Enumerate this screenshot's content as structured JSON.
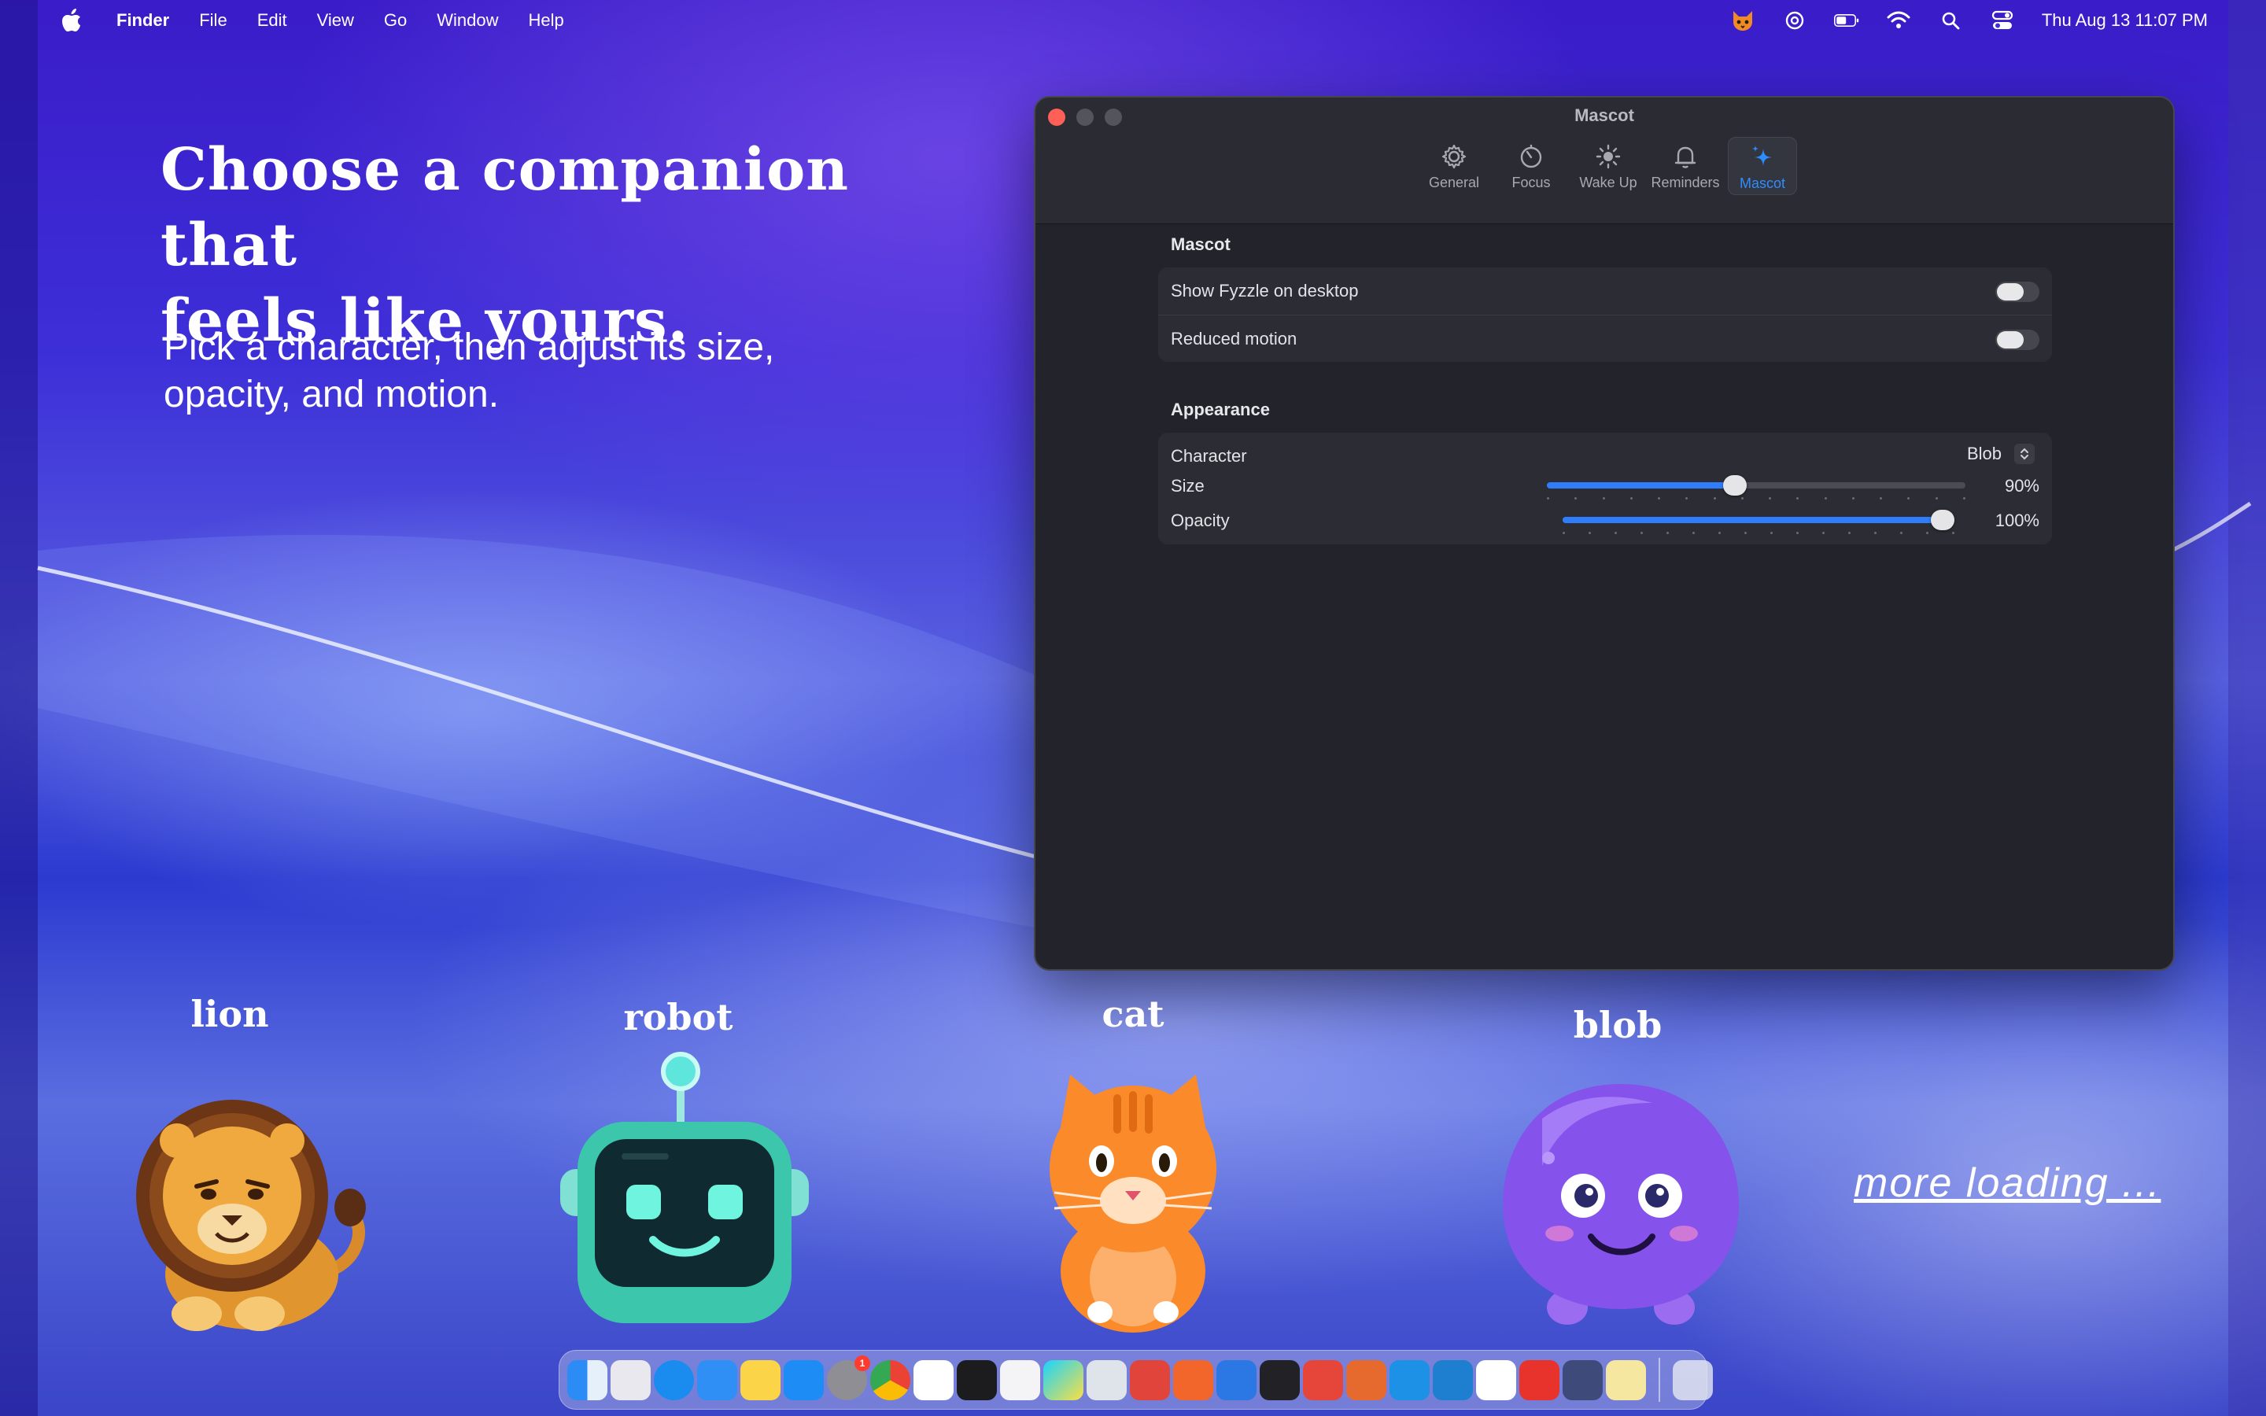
{
  "menubar": {
    "app_name": "Finder",
    "menus": [
      "File",
      "Edit",
      "View",
      "Go",
      "Window",
      "Help"
    ],
    "status_icons": [
      "mascot-cat-icon",
      "chatgpt-icon",
      "battery-icon",
      "wifi-icon",
      "spotlight-search-icon",
      "control-center-icon"
    ],
    "clock": "Thu Aug 13  11:07 PM"
  },
  "hero": {
    "title_line1": "Choose a companion that",
    "title_line2": "feels like yours.",
    "subtitle_line1": "Pick a character, then adjust its size,",
    "subtitle_line2": "opacity, and motion."
  },
  "window": {
    "title": "Mascot",
    "tabs": [
      {
        "label": "General",
        "icon": "gear-icon"
      },
      {
        "label": "Focus",
        "icon": "timer-icon"
      },
      {
        "label": "Wake Up",
        "icon": "sun-icon"
      },
      {
        "label": "Reminders",
        "icon": "bell-icon"
      },
      {
        "label": "Mascot",
        "icon": "sparkles-icon",
        "active": true
      }
    ],
    "mascot_section": {
      "heading": "Mascot",
      "show_on_desktop_label": "Show Fyzzle on desktop",
      "show_on_desktop": false,
      "reduced_motion_label": "Reduced motion",
      "reduced_motion": false
    },
    "appearance_section": {
      "heading": "Appearance",
      "character_label": "Character",
      "character_value": "Blob",
      "size_label": "Size",
      "size_value": "90%",
      "size_fraction": 0.45,
      "opacity_label": "Opacity",
      "opacity_value": "100%",
      "opacity_fraction": 1.0
    }
  },
  "mascots": [
    {
      "name": "lion"
    },
    {
      "name": "robot"
    },
    {
      "name": "cat"
    },
    {
      "name": "blob"
    }
  ],
  "more_loading": "more loading ...",
  "dock": {
    "apps": [
      "finder-icon",
      "launchpad-icon",
      "safari-icon",
      "mail-icon",
      "notes-icon",
      "app-store-icon",
      "system-settings-icon",
      "chrome-icon",
      "slack-icon",
      "terminal-icon",
      "font-book-icon",
      "webstorm-icon",
      "postgres-icon",
      "todoist-icon",
      "pen-app-icon",
      "xcode-icon",
      "box-icon",
      "affinity-icon",
      "claude-icon",
      "docker-icon",
      "vscode-icon",
      "notion-icon",
      "wps-icon",
      "remote-icon",
      "preview-icon"
    ],
    "settings_badge": "1",
    "trash": "trash-icon"
  },
  "colors": {
    "accent": "#2f7dfb",
    "window_bg": "#22232b",
    "close": "#fe5f57"
  }
}
